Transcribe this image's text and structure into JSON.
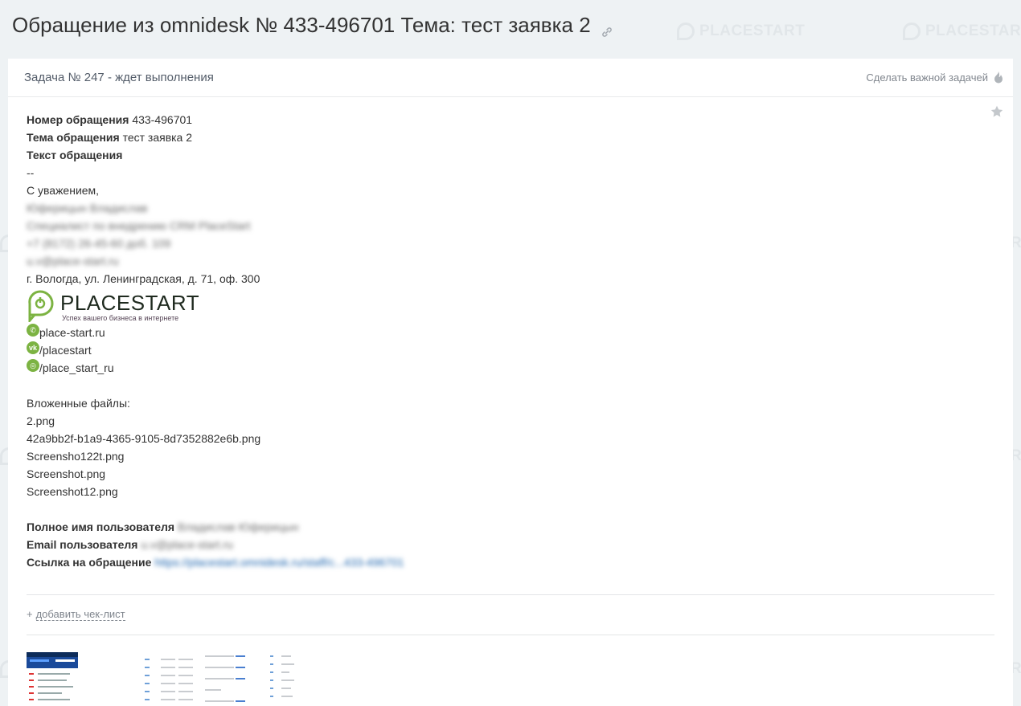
{
  "page": {
    "title": "Обращение из omnidesk № 433-496701 Тема: тест заявка 2"
  },
  "header": {
    "task_status": "Задача № 247 - ждет выполнения",
    "make_important": "Сделать важной задачей"
  },
  "ticket": {
    "number_label": "Номер обращения",
    "number_value": "433-496701",
    "subject_label": "Тема обращения",
    "subject_value": "тест заявка 2",
    "text_label": "Текст обращения",
    "dash": "--",
    "regards": "С уважением,",
    "sender_name": "Юферицын Владислав",
    "sender_position": "Специалист по внедрению CRM PlaceStart",
    "phone": "+7 (8172) 26-45-60 доб. 109",
    "email": "u.v@place-start.ru",
    "address": "г. Вологда, ул. Ленинградская, д. 71, оф. 300"
  },
  "logo": {
    "name": "PLACESTART",
    "slogan": "Успех вашего бизнеса в интернете"
  },
  "socials": [
    {
      "icon": "whatsapp-icon",
      "text": "place-start.ru"
    },
    {
      "icon": "vk-icon",
      "text": "/placestart"
    },
    {
      "icon": "instagram-icon",
      "text": "/place_start_ru"
    }
  ],
  "attachments": {
    "label": "Вложенные файлы:",
    "files": [
      "2.png",
      "42a9bb2f-b1a9-4365-9105-8d7352882e6b.png",
      "Screensho122t.png",
      "Screenshot.png",
      "Screenshot12.png"
    ]
  },
  "user": {
    "fullname_label": "Полное имя пользователя",
    "fullname_value": "Владислав Юферицын",
    "email_label": "Email пользователя",
    "email_value": "u.v@place-start.ru",
    "link_label": "Ссылка на обращение",
    "link_value": "https://placestart.omnidesk.ru/staff/c...433-496701"
  },
  "checklist": {
    "plus": "+",
    "label": "добавить чек-лист"
  },
  "watermark_text": "PLACESTART",
  "colors": {
    "background": "#eef2f4",
    "accent_green": "#7cb342",
    "link_blue": "#2067b0"
  }
}
